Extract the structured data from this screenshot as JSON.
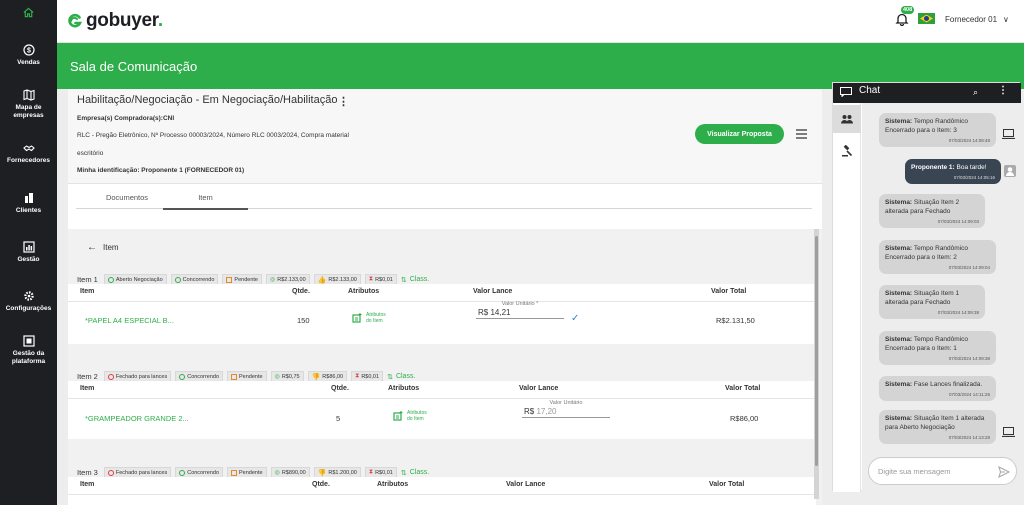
{
  "sidebar": {
    "items": [
      {
        "label": "Vendas",
        "icon": "dollar-icon"
      },
      {
        "label": "Mapa de empresas",
        "icon": "map-icon"
      },
      {
        "label": "Fornecedores",
        "icon": "handshake-icon"
      },
      {
        "label": "Clientes",
        "icon": "building-icon"
      },
      {
        "label": "Gestão",
        "icon": "chart-icon"
      },
      {
        "label": "Configurações",
        "icon": "gear-icon"
      },
      {
        "label": "Gestão da plataforma",
        "icon": "platform-icon"
      }
    ]
  },
  "topbar": {
    "logo_text": "gobuyer",
    "logo_dot": ".",
    "notif_count": "408",
    "user_name": "Fornecedor 01",
    "chevron": "∨"
  },
  "header": {
    "title": "Sala de Comunicação"
  },
  "process": {
    "title": "Habilitação/Negociação - Em Negociação/Habilitação",
    "kebab": "⋮",
    "buyer_companies": "Empresa(s) Compradora(s):CNI",
    "description": "RLC - Pregão Eletrônico, Nº Processo 00003/2024, Número RLC 0003/2024, Compra material",
    "description2": "escritório",
    "identification": "Minha identificação: Proponente 1 (FORNECEDOR 01)",
    "proposal_button": "Visualizar Proposta"
  },
  "tabs": [
    {
      "label": "Documentos",
      "active": false
    },
    {
      "label": "Item",
      "active": true
    }
  ],
  "back_label": "Item",
  "columns": {
    "item": "Item",
    "qty": "Qtde.",
    "attrs": "Atributos",
    "bid": "Valor Lance",
    "total": "Valor Total"
  },
  "attr_label_1": "Atributos",
  "attr_label_2": "do Item",
  "class_label": "Class.",
  "items": [
    {
      "label": "Item 1",
      "status": "Aberto Negociação",
      "competing": "Concorrendo",
      "pending": "Pendente",
      "best_value": "R$2.133,00",
      "my_value": "R$2.133,00",
      "timer": "R$0,01",
      "name": "*PAPEL A4 ESPECIAL B...",
      "qty": "150",
      "bid_caption": "Valor Unitário *",
      "bid_value": "R$ 14,21",
      "total": "R$2.131,50"
    },
    {
      "label": "Item 2",
      "status": "Fechado para lances",
      "competing": "Concorrendo",
      "pending": "Pendente",
      "best_value": "R$0,75",
      "my_value": "R$86,00",
      "timer": "R$0,01",
      "name": "*GRAMPEADOR GRANDE 2...",
      "qty": "5",
      "bid_caption": "Valor Unitário",
      "bid_prefix": "R$",
      "bid_value": "17,20",
      "total": "R$86,00"
    },
    {
      "label": "Item 3",
      "status": "Fechado para lances",
      "competing": "Concorrendo",
      "pending": "Pendente",
      "best_value": "R$890,00",
      "my_value": "R$1.200,00",
      "timer": "R$0,01"
    }
  ],
  "chat": {
    "title": "Chat",
    "placeholder": "Digite sua mensagem",
    "messages": [
      {
        "sender": "Sistema:",
        "text": "Tempo Randômico Encerrado para o Item: 3",
        "time": "07/03/2024 14:08:48",
        "mine": false
      },
      {
        "sender": "Proponente 1:",
        "text": "Boa tarde!",
        "time": "07/03/2024 14:05:16",
        "mine": true
      },
      {
        "sender": "Sistema:",
        "text": "Situação Item 2 alterada para Fechado",
        "time": "07/03/2024 14:09:03",
        "mine": false
      },
      {
        "sender": "Sistema:",
        "text": "Tempo Randômico Encerrado para o Item: 2",
        "time": "07/03/2024 14:09:04",
        "mine": false
      },
      {
        "sender": "Sistema:",
        "text": "Situação Item 1 alterada para Fechado",
        "time": "07/03/2024 14:09:38",
        "mine": false
      },
      {
        "sender": "Sistema:",
        "text": "Tempo Randômico Encerrado para o Item: 1",
        "time": "07/03/2024 14:09:38",
        "mine": false
      },
      {
        "sender": "Sistema:",
        "text": "Fase Lances finalizada.",
        "time": "07/03/2024 14:11:26",
        "mine": false
      },
      {
        "sender": "Sistema:",
        "text": "Situação Item 1 alterada para Aberto Negociação",
        "time": "07/03/2024 14:13:28",
        "mine": false
      }
    ]
  }
}
